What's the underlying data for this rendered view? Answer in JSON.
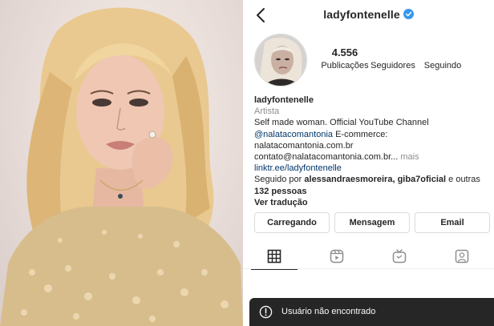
{
  "profile": {
    "username": "ladyfontenelle",
    "verified": true,
    "stats": {
      "posts_count": "4.556",
      "posts_label": "Publicações",
      "followers_count": "",
      "followers_label": "Seguidores",
      "following_count": "",
      "following_label": "Seguindo"
    },
    "bio": {
      "name": "ladyfontenelle",
      "category": "Artista",
      "line1": "Self made woman. Official YouTube Channel",
      "mention": "@nalatacomantonia",
      "line2_rest": " E-commerce:",
      "line3": "nalatacomantonia.com.br",
      "line4": "contato@nalatacomantonia.com.br...",
      "more": " mais",
      "website": "linktr.ee/ladyfontenelle",
      "followed_by_prefix": "Seguido por ",
      "followed_by_names": "alessandraesmoreira, giba7oficial",
      "followed_by_and": " e outras",
      "followed_by_count": "132 pessoas",
      "translate": "Ver tradução"
    }
  },
  "buttons": {
    "loading": "Carregando",
    "message": "Mensagem",
    "email": "Email"
  },
  "tabs": [
    {
      "icon": "grid-icon",
      "active": true
    },
    {
      "icon": "reels-icon",
      "active": false
    },
    {
      "icon": "igtv-icon",
      "active": false
    },
    {
      "icon": "tagged-icon",
      "active": false
    }
  ],
  "toast": {
    "icon": "alert-circle-icon",
    "text": "Usuário não encontrado"
  },
  "colors": {
    "verified_blue": "#3897f0",
    "link_blue": "#00376b",
    "toast_bg": "#262626"
  }
}
